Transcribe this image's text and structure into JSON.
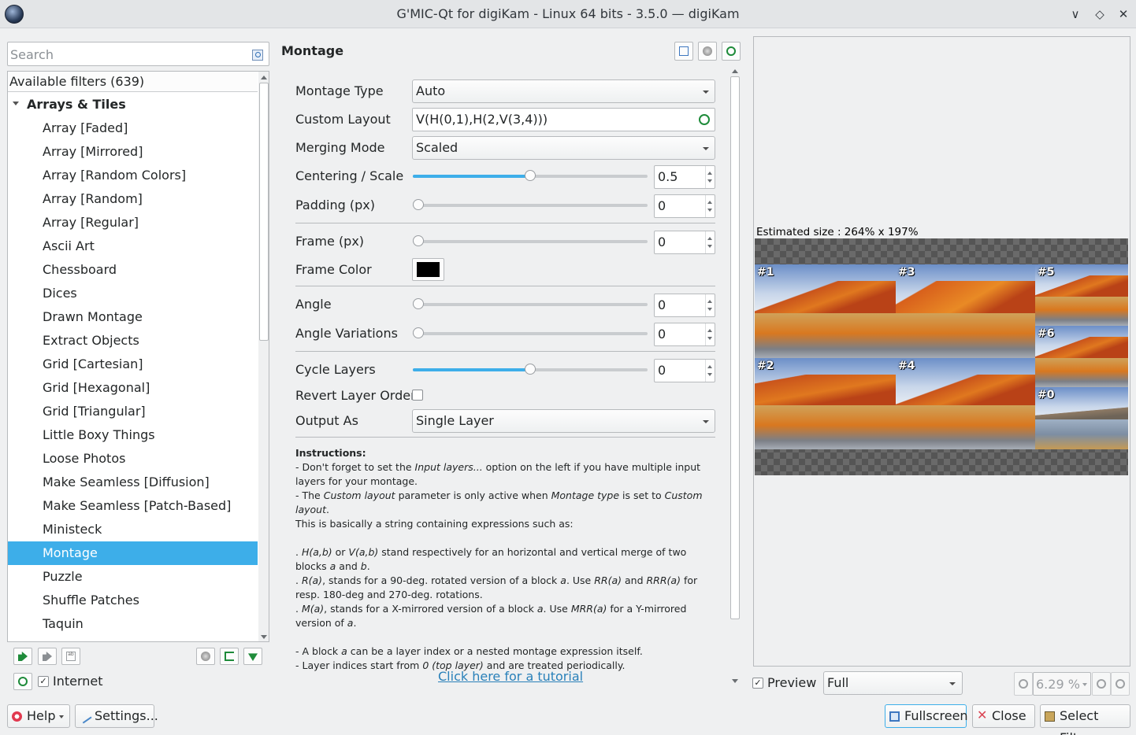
{
  "window": {
    "title": "G'MIC-Qt for digiKam - Linux 64 bits - 3.5.0 — digiKam"
  },
  "search": {
    "placeholder": "Search"
  },
  "filters": {
    "header": "Available filters (639)",
    "category": "Arrays & Tiles",
    "items": [
      "Array [Faded]",
      "Array [Mirrored]",
      "Array [Random Colors]",
      "Array [Random]",
      "Array [Regular]",
      "Ascii Art",
      "Chessboard",
      "Dices",
      "Drawn Montage",
      "Extract Objects",
      "Grid [Cartesian]",
      "Grid [Hexagonal]",
      "Grid [Triangular]",
      "Little Boxy Things",
      "Loose Photos",
      "Make Seamless [Diffusion]",
      "Make Seamless [Patch-Based]",
      "Ministeck",
      "Montage",
      "Puzzle",
      "Shuffle Patches",
      "Taquin"
    ],
    "selected_index": 18,
    "internet_label": "Internet",
    "internet_checked": true
  },
  "buttons": {
    "help": "Help",
    "settings": "Settings...",
    "fullscreen": "Fullscreen",
    "close": "Close",
    "select_filter": "Select Filter"
  },
  "filter_panel": {
    "title": "Montage",
    "params": {
      "montage_type": {
        "label": "Montage Type",
        "value": "Auto"
      },
      "custom_layout": {
        "label": "Custom Layout",
        "value": "V(H(0,1),H(2,V(3,4)))"
      },
      "merging_mode": {
        "label": "Merging Mode",
        "value": "Scaled"
      },
      "centering_scale": {
        "label": "Centering / Scale",
        "value": "0.5",
        "level": 0.5
      },
      "padding": {
        "label": "Padding (px)",
        "value": "0",
        "level": 0
      },
      "frame": {
        "label": "Frame (px)",
        "value": "0",
        "level": 0
      },
      "frame_color": {
        "label": "Frame Color",
        "color": "#000000"
      },
      "angle": {
        "label": "Angle",
        "value": "0",
        "level": 0
      },
      "angle_variations": {
        "label": "Angle Variations",
        "value": "0",
        "level": 0
      },
      "cycle_layers": {
        "label": "Cycle Layers",
        "value": "0",
        "level": 0.5
      },
      "revert_layer_order": {
        "label": "Revert Layer Order",
        "checked": false
      },
      "output_as": {
        "label": "Output As",
        "value": "Single Layer"
      }
    },
    "instructions": {
      "heading": "Instructions:",
      "line1a": "- Don't forget to set the ",
      "line1i": "Input layers...",
      "line1b": " option on the left if you have multiple input layers for your montage.",
      "line2a": "- The ",
      "line2i1": "Custom layout",
      "line2b": " parameter is only active when ",
      "line2i2": "Montage type",
      "line2c": " is set to ",
      "line2i3": "Custom layout",
      "line2d": ".",
      "line3": "This is basically a string containing expressions such as:",
      "bullet1a": ". ",
      "bullet1i1": "H(a,b)",
      "bullet1b": " or ",
      "bullet1i2": "V(a,b)",
      "bullet1c": " stand respectively for an horizontal and vertical merge of two blocks ",
      "bullet1i3": "a",
      "bullet1d": " and ",
      "bullet1i4": "b",
      "bullet1e": ".",
      "bullet2a": ". ",
      "bullet2i1": "R(a)",
      "bullet2b": ", stands for a 90-deg. rotated version of a block ",
      "bullet2i2": "a",
      "bullet2c": ". Use ",
      "bullet2i3": "RR(a)",
      "bullet2d": " and ",
      "bullet2i4": "RRR(a)",
      "bullet2e": " for resp. 180-deg and 270-deg. rotations.",
      "bullet3a": ". ",
      "bullet3i1": "M(a)",
      "bullet3b": ", stands for a X-mirrored version of a block ",
      "bullet3i2": "a",
      "bullet3c": ". Use ",
      "bullet3i3": "MRR(a)",
      "bullet3d": " for a Y-mirrored version of ",
      "bullet3i4": "a",
      "bullet3e": ".",
      "line4a": "- A block ",
      "line4i": "a",
      "line4b": " can be a layer index or a nested montage expression itself.",
      "line5a": "- Layer indices start from ",
      "line5i": "0 (top layer)",
      "line5b": " and are treated periodically.",
      "tutorial": "Click here for a tutorial"
    }
  },
  "preview": {
    "estimated_size": "Estimated size :  264% x 197%",
    "tiles": [
      "#1",
      "#3",
      "#5",
      "#6",
      "#2",
      "#4",
      "#0"
    ],
    "preview_label": "Preview",
    "preview_checked": true,
    "mode": "Full",
    "zoom": "6.29 %"
  },
  "colors": {
    "accent": "#3daee9",
    "link": "#2980b9"
  }
}
